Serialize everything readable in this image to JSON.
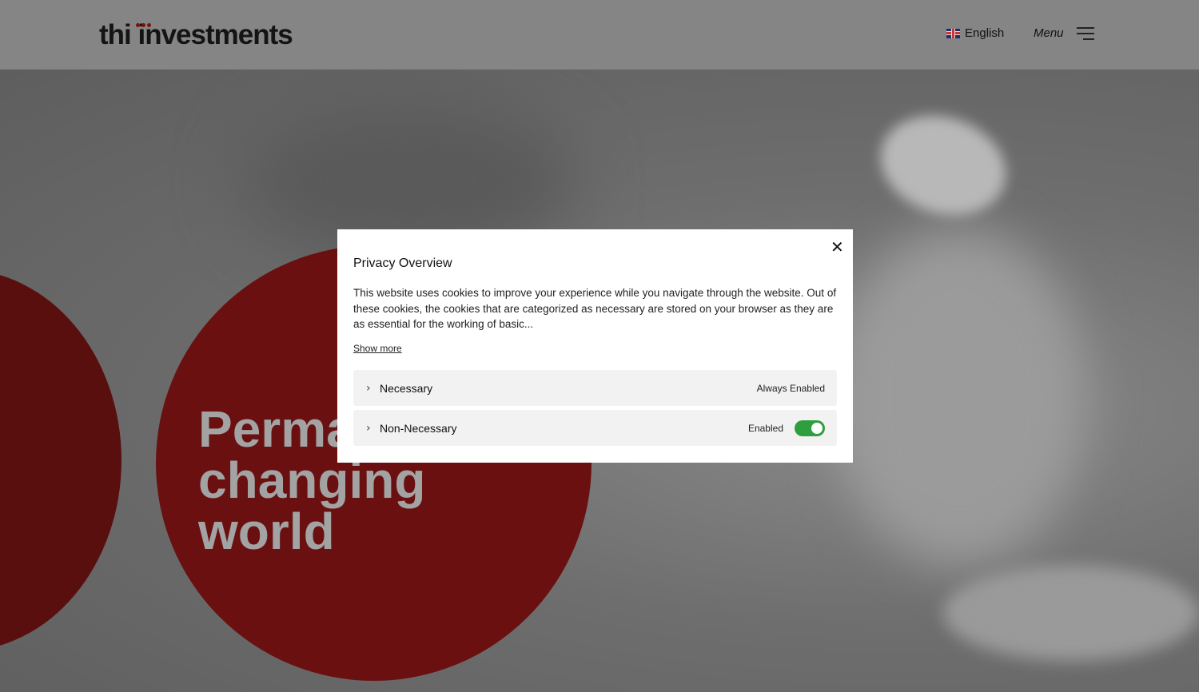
{
  "header": {
    "logo_text": "thi investments",
    "language_label": "English",
    "menu_label": "Menu"
  },
  "hero": {
    "title_line1": "Permanent capital for a changing",
    "title_line2": "world"
  },
  "cookie_modal": {
    "title": "Privacy Overview",
    "description": "This website uses cookies to improve your experience while you navigate through the website. Out of these cookies, the cookies that are categorized as necessary are stored on your browser as they are as essential for the working of basic...",
    "show_more_label": "Show more",
    "categories": [
      {
        "label": "Necessary",
        "status": "Always Enabled"
      },
      {
        "label": "Non-Necessary",
        "status": "Enabled",
        "toggle_on": true
      }
    ]
  },
  "colors": {
    "brand_red": "#7a1010",
    "toggle_green": "#2f9e3f"
  }
}
